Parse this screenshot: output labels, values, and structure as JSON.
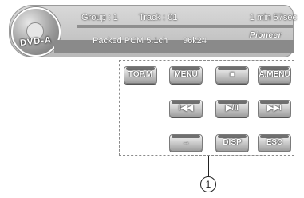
{
  "status": {
    "disc_label": "DVD-A",
    "group": "Group : 1",
    "track": "Track : 01",
    "time": "1 min 57sec",
    "brand": "Pioneer",
    "format": "Packed PCM 5.1ch",
    "rate": "96k24"
  },
  "keys": {
    "top_menu": "TOP.M",
    "menu": "MENU",
    "stop": "■",
    "audio_menu": "A.MENU",
    "prev": "I◀◀",
    "play_pause": "▶/II",
    "next": "▶▶I",
    "next_page": "→",
    "display": "DISP",
    "escape": "ESC"
  },
  "callout": {
    "number": "1"
  }
}
